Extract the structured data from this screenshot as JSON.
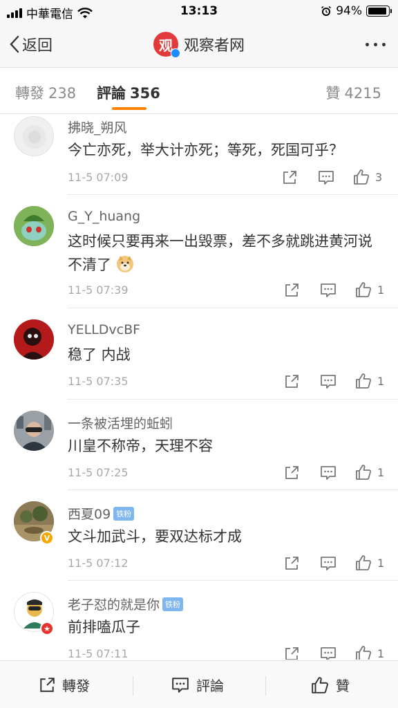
{
  "status_bar": {
    "carrier": "中華電信",
    "time": "13:13",
    "battery": "94%",
    "battery_level": 0.94
  },
  "nav": {
    "back_label": "返回",
    "title": "观察者网",
    "logo_char": "观"
  },
  "tabs": {
    "repost": {
      "label": "轉發",
      "count": "238"
    },
    "comment": {
      "label": "評論",
      "count": "356"
    },
    "like": {
      "label": "贊",
      "count": "4215"
    }
  },
  "comments": [
    {
      "user": "拂晓_朔风",
      "text": "今亡亦死，举大计亦死；等死，死国可乎？",
      "time": "11-5 07:09",
      "likes": "3"
    },
    {
      "user": "G_Y_huang",
      "text": "这时候只要再来一出毁票，差不多就跳进黄河说不清了",
      "emoji": "doge",
      "time": "11-5 07:39",
      "likes": "1"
    },
    {
      "user": "YELLDvcBF",
      "text": "稳了 内战",
      "time": "11-5 07:35",
      "likes": "1"
    },
    {
      "user": "一条被活埋的蚯蚓",
      "text": "川皇不称帝，天理不容",
      "time": "11-5 07:25",
      "likes": "1"
    },
    {
      "user": "西夏09",
      "fan_badge": "铁粉",
      "text": "文斗加武斗，要双达标才成",
      "time": "11-5 07:12",
      "likes": "1"
    },
    {
      "user": "老子怼的就是你",
      "fan_badge": "铁粉",
      "text": "前排嗑瓜子",
      "time": "11-5 07:11",
      "likes": "1"
    }
  ],
  "bottom_bar": {
    "repost": "轉發",
    "comment": "評論",
    "like": "贊"
  },
  "colors": {
    "accent": "#ff8200",
    "verified": "#1a8cff",
    "logo": "#e23a3a",
    "fan_badge": "#7fb6f0"
  }
}
